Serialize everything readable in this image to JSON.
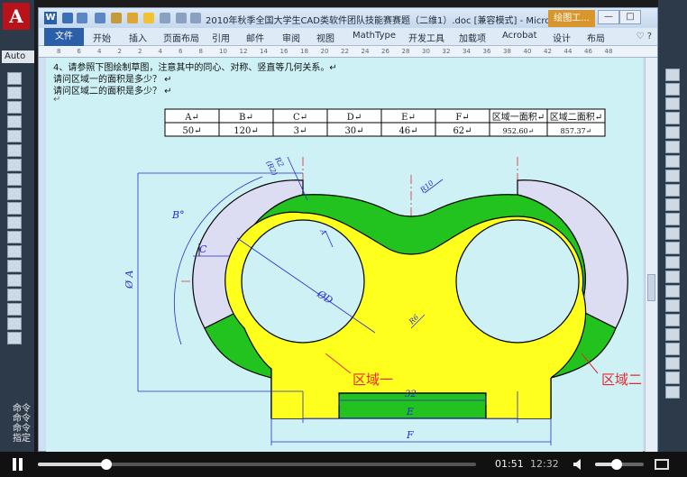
{
  "cad": {
    "logo_letter": "A",
    "workspace_label": "Auto",
    "command_lines": [
      "命令",
      "命令",
      "命令",
      "指定"
    ]
  },
  "word": {
    "title": "2010年秋季全国大学生CAD类软件团队技能赛赛题（二维1）.doc [兼容模式] - Microsoft ...",
    "drawing_tools_tab": "绘图工...",
    "window_buttons": {
      "minimize": "—",
      "maximize": "□",
      "close": "✕"
    },
    "tabs": [
      "文件",
      "开始",
      "插入",
      "页面布局",
      "引用",
      "邮件",
      "审阅",
      "视图",
      "MathType",
      "开发工具",
      "加载项",
      "Acrobat",
      "设计",
      "布局"
    ],
    "ruler_numbers": [
      "8",
      "6",
      "4",
      "2",
      "2",
      "4",
      "6",
      "8",
      "10",
      "12",
      "14",
      "16",
      "18",
      "20",
      "22",
      "24",
      "26",
      "28",
      "30",
      "32",
      "34",
      "36",
      "38",
      "40",
      "42",
      "44",
      "46",
      "48"
    ]
  },
  "document": {
    "question_intro": "4、请参照下图绘制草图，注意其中的同心、对称、竖直等几何关系。↵",
    "question_1": "请问区域一的面积是多少？ ↵",
    "question_2": "请问区域二的面积是多少？ ↵",
    "blank_mark": "↵",
    "table_headers": [
      "A↵",
      "B↵",
      "C↵",
      "D↵",
      "E↵",
      "F↵",
      "区域一面积↵",
      "区域二面积↵"
    ],
    "table_values": [
      "50↵",
      "120↵",
      "3↵",
      "30↵",
      "46↵",
      "62↵",
      "952.60↵",
      "857.37↵"
    ]
  },
  "drawing_labels": {
    "region_1": "区域一",
    "region_2": "区域二",
    "dim_a": "A",
    "dim_b": "B°",
    "dim_c": "C",
    "dim_d": "ØD",
    "dim_e": "E",
    "dim_f": "F",
    "dim_32": "32",
    "dim_r10": "R10",
    "dim_r6": "R6",
    "dim_r2": "R2",
    "dim_r2_paren": "(R2)",
    "dim_phi_a": "Ø A"
  },
  "player": {
    "current_time": "01:51",
    "total_time": "12:32",
    "progress_fraction": 0.156,
    "volume_fraction": 0.45
  },
  "colors": {
    "green": "#22c31e",
    "yellow": "#ffff1e",
    "lavender": "#dcdcf3",
    "dimension_blue": "#2a2ad2",
    "center_red": "#e8292c",
    "page_bg": "#cdf1f5"
  }
}
